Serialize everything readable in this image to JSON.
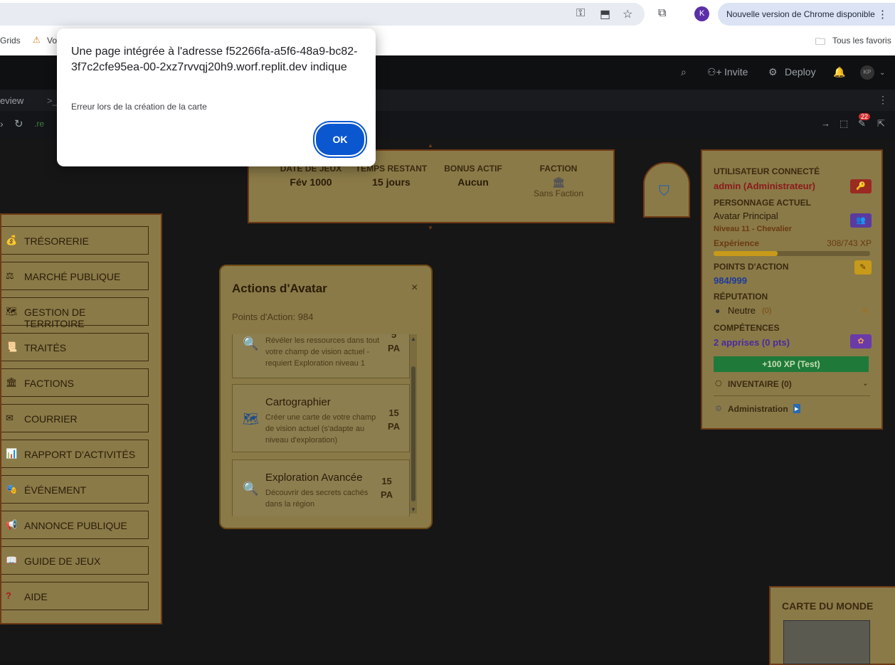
{
  "browser": {
    "bookmark_left": "Grids",
    "bookmark_second": "Vo",
    "bookmark_folder": "Tous les favoris",
    "profile_initial": "K",
    "update_label": "Nouvelle version de Chrome disponible",
    "menu_glyph": "⋮"
  },
  "replit": {
    "invite_label": "Invite",
    "deploy_label": "Deploy",
    "avatar_initials": "KP",
    "tab_label": "eview",
    "tab_icon": ">_",
    "address_prefix": ".re",
    "notif_count": "22"
  },
  "dialog": {
    "title": "Une page intégrée à l'adresse f52266fa-a5f6-48a9-bc82-3f7c2cfe95ea-00-2xz7rvvqj20h9.worf.replit.dev indique",
    "message": "Erreur lors de la création de la carte",
    "ok_label": "OK"
  },
  "infobar": {
    "date_label": "DATE DE JEUX",
    "date_value": "Fév 1000",
    "time_label": "TEMPS RESTANT",
    "time_value": "15 jours",
    "bonus_label": "BONUS ACTIF",
    "bonus_value": "Aucun",
    "faction_label": "FACTION",
    "faction_value": "Sans Faction"
  },
  "menu": [
    {
      "label": "TRÉSORERIE",
      "icon": "💰"
    },
    {
      "label": "MARCHÉ PUBLIQUE",
      "icon": "⚖"
    },
    {
      "label": "GESTION DE TERRITOIRE",
      "icon": "🗺"
    },
    {
      "label": "TRAITÉS",
      "icon": "📜"
    },
    {
      "label": "FACTIONS",
      "icon": "🏛"
    },
    {
      "label": "COURRIER",
      "icon": "✉"
    },
    {
      "label": "RAPPORT D'ACTIVITÉS",
      "icon": "📊"
    },
    {
      "label": "ÉVÉNEMENT",
      "icon": "🎭"
    },
    {
      "label": "ANNONCE PUBLIQUE",
      "icon": "📢"
    },
    {
      "label": "GUIDE DE JEUX",
      "icon": "📖"
    },
    {
      "label": "AIDE",
      "icon": "?"
    }
  ],
  "actions": {
    "title": "Actions d'Avatar",
    "close": "×",
    "points_text": "Points d'Action: 984",
    "items": [
      {
        "title": "",
        "desc": "Révéler les ressources dans tout votre champ de vision actuel - requiert Exploration niveau 1",
        "cost": "5",
        "unit": "PA",
        "icon": "search-icon"
      },
      {
        "title": "Cartographier",
        "desc": "Créer une carte de votre champ de vision actuel (s'adapte au niveau d'exploration)",
        "cost": "15",
        "unit": "PA",
        "icon": "map-icon"
      },
      {
        "title": "Exploration Avancée",
        "desc": "Découvrir des secrets cachés dans la région",
        "cost": "15",
        "unit": "PA",
        "icon": "search-icon"
      }
    ]
  },
  "user": {
    "connected_label": "UTILISATEUR CONNECTÉ",
    "connected_value": "admin (Administrateur)",
    "character_label": "PERSONNAGE ACTUEL",
    "character_value": "Avatar Principal",
    "level_value": "Niveau 11 - Chevalier",
    "xp_label": "Expérience",
    "xp_value": "308/743 XP",
    "xp_fraction": 0.41,
    "ap_label": "POINTS D'ACTION",
    "ap_value": "984/999",
    "rep_label": "RÉPUTATION",
    "rep_value": "Neutre",
    "rep_count": "(0)",
    "skills_label": "COMPÉTENCES",
    "skills_value": "2 apprises (0 pts)",
    "xp_button": "+100 XP (Test)",
    "inventory_label": "INVENTAIRE (0)",
    "admin_label": "Administration"
  },
  "worldmap": {
    "title": "CARTE DU MONDE"
  }
}
